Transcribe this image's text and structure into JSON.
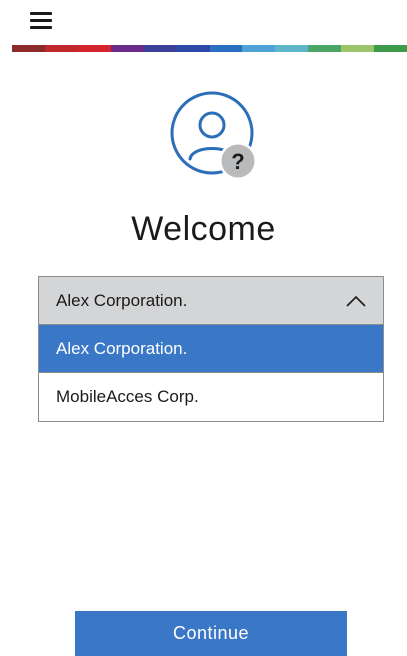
{
  "header": {
    "menu_icon": "hamburger-menu-icon",
    "color_strip": [
      "#8b2b2b",
      "#c0282c",
      "#d4242e",
      "#6a2c8c",
      "#3a3f9a",
      "#2d4aa8",
      "#2a6fc0",
      "#4da3d6",
      "#5cb8c9",
      "#4aa566",
      "#9cc46b",
      "#3d9a4a"
    ]
  },
  "hero": {
    "avatar_icon": "user-help-icon",
    "title": "Welcome"
  },
  "dropdown": {
    "selected_value": "Alex Corporation.",
    "chevron_icon": "chevron-up-icon",
    "options": [
      {
        "label": "Alex Corporation.",
        "selected": true
      },
      {
        "label": "MobileAcces Corp.",
        "selected": false
      }
    ]
  },
  "footer": {
    "continue_label": "Continue"
  },
  "colors": {
    "accent": "#3a78c7",
    "dropdown_header_bg": "#d4d5d7",
    "avatar_stroke": "#2c6fb8",
    "help_badge": "#b9babc"
  }
}
